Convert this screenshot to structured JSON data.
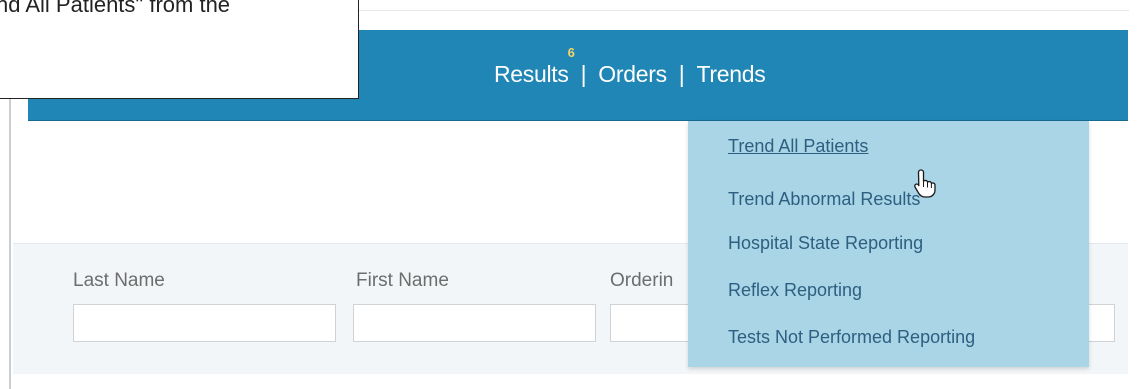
{
  "callout": {
    "text": "nd All Patients\" from the"
  },
  "nav": {
    "results_label": "Results",
    "results_badge": "6",
    "orders_label": "Orders",
    "trends_label": "Trends",
    "separator": "|"
  },
  "trends_menu": {
    "items": [
      "Trend All Patients",
      "Trend Abnormal Results",
      "Hospital State Reporting",
      "Reflex Reporting",
      "Tests Not Performed Reporting"
    ],
    "hovered_item": "Trend All Patients"
  },
  "filters": {
    "last_name_label": "Last Name",
    "first_name_label": "First Name",
    "ordering_label": "Orderin"
  },
  "colors": {
    "nav_bar": "#1f86b5",
    "dropdown_bg": "#a9d5e7",
    "menu_link": "#2d5f80",
    "badge": "#f4d36b"
  },
  "icons": {
    "cursor": "hand-pointer-icon"
  }
}
